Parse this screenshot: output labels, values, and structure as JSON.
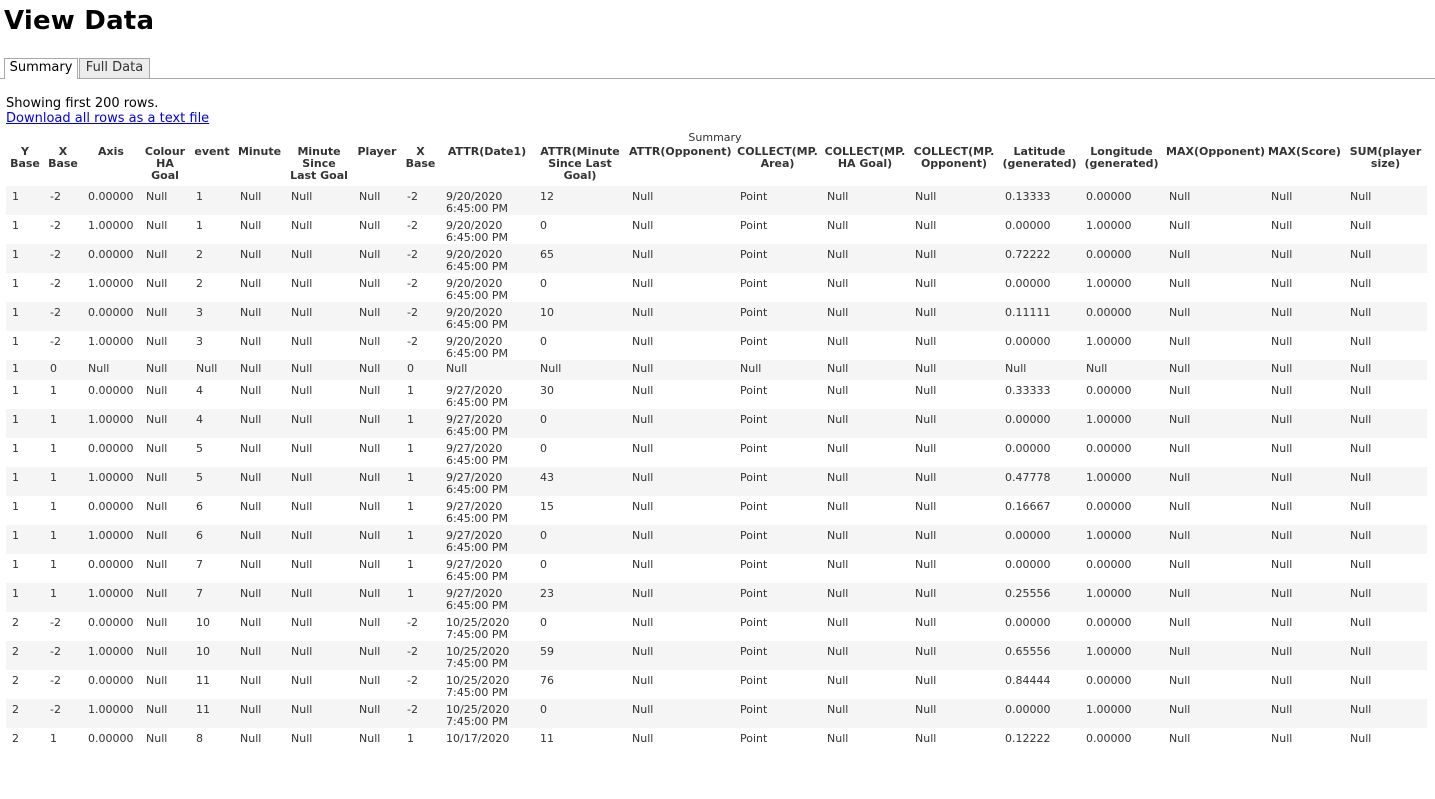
{
  "page": {
    "title": "View Data"
  },
  "tabs": [
    {
      "label": "Summary",
      "active": true
    },
    {
      "label": "Full Data",
      "active": false
    }
  ],
  "info": {
    "showing": "Showing first 200 rows.",
    "download": "Download all rows as a text file"
  },
  "table": {
    "caption": "Summary",
    "columns": [
      [
        "Y",
        "Base"
      ],
      [
        "X",
        "Base"
      ],
      [
        "Axis"
      ],
      [
        "Colour",
        "HA",
        "Goal"
      ],
      [
        "event"
      ],
      [
        "Minute"
      ],
      [
        "Minute",
        "Since",
        "Last Goal"
      ],
      [
        "Player"
      ],
      [
        "X",
        "Base"
      ],
      [
        "ATTR(Date1)"
      ],
      [
        "ATTR(Minute",
        "Since Last",
        "Goal)"
      ],
      [
        "ATTR(Opponent)"
      ],
      [
        "COLLECT(MP.",
        "Area)"
      ],
      [
        "COLLECT(MP.",
        "HA Goal)"
      ],
      [
        "COLLECT(MP.",
        "Opponent)"
      ],
      [
        "Latitude",
        "(generated)"
      ],
      [
        "Longitude",
        "(generated)"
      ],
      [
        "MAX(Opponent)"
      ],
      [
        "MAX(Score)"
      ],
      [
        "SUM(player",
        "size)"
      ]
    ],
    "rows": [
      [
        "1",
        "-2",
        "0.00000",
        "Null",
        "1",
        "Null",
        "Null",
        "Null",
        "-2",
        [
          "9/20/2020",
          "6:45:00 PM"
        ],
        "12",
        "Null",
        "Point",
        "Null",
        "Null",
        "0.13333",
        "0.00000",
        "Null",
        "Null",
        "Null"
      ],
      [
        "1",
        "-2",
        "1.00000",
        "Null",
        "1",
        "Null",
        "Null",
        "Null",
        "-2",
        [
          "9/20/2020",
          "6:45:00 PM"
        ],
        "0",
        "Null",
        "Point",
        "Null",
        "Null",
        "0.00000",
        "1.00000",
        "Null",
        "Null",
        "Null"
      ],
      [
        "1",
        "-2",
        "0.00000",
        "Null",
        "2",
        "Null",
        "Null",
        "Null",
        "-2",
        [
          "9/20/2020",
          "6:45:00 PM"
        ],
        "65",
        "Null",
        "Point",
        "Null",
        "Null",
        "0.72222",
        "0.00000",
        "Null",
        "Null",
        "Null"
      ],
      [
        "1",
        "-2",
        "1.00000",
        "Null",
        "2",
        "Null",
        "Null",
        "Null",
        "-2",
        [
          "9/20/2020",
          "6:45:00 PM"
        ],
        "0",
        "Null",
        "Point",
        "Null",
        "Null",
        "0.00000",
        "1.00000",
        "Null",
        "Null",
        "Null"
      ],
      [
        "1",
        "-2",
        "0.00000",
        "Null",
        "3",
        "Null",
        "Null",
        "Null",
        "-2",
        [
          "9/20/2020",
          "6:45:00 PM"
        ],
        "10",
        "Null",
        "Point",
        "Null",
        "Null",
        "0.11111",
        "0.00000",
        "Null",
        "Null",
        "Null"
      ],
      [
        "1",
        "-2",
        "1.00000",
        "Null",
        "3",
        "Null",
        "Null",
        "Null",
        "-2",
        [
          "9/20/2020",
          "6:45:00 PM"
        ],
        "0",
        "Null",
        "Point",
        "Null",
        "Null",
        "0.00000",
        "1.00000",
        "Null",
        "Null",
        "Null"
      ],
      [
        "1",
        "0",
        "Null",
        "Null",
        "Null",
        "Null",
        "Null",
        "Null",
        "0",
        [
          "Null"
        ],
        "Null",
        "Null",
        "Null",
        "Null",
        "Null",
        "Null",
        "Null",
        "Null",
        "Null",
        "Null"
      ],
      [
        "1",
        "1",
        "0.00000",
        "Null",
        "4",
        "Null",
        "Null",
        "Null",
        "1",
        [
          "9/27/2020",
          "6:45:00 PM"
        ],
        "30",
        "Null",
        "Point",
        "Null",
        "Null",
        "0.33333",
        "0.00000",
        "Null",
        "Null",
        "Null"
      ],
      [
        "1",
        "1",
        "1.00000",
        "Null",
        "4",
        "Null",
        "Null",
        "Null",
        "1",
        [
          "9/27/2020",
          "6:45:00 PM"
        ],
        "0",
        "Null",
        "Point",
        "Null",
        "Null",
        "0.00000",
        "1.00000",
        "Null",
        "Null",
        "Null"
      ],
      [
        "1",
        "1",
        "0.00000",
        "Null",
        "5",
        "Null",
        "Null",
        "Null",
        "1",
        [
          "9/27/2020",
          "6:45:00 PM"
        ],
        "0",
        "Null",
        "Point",
        "Null",
        "Null",
        "0.00000",
        "0.00000",
        "Null",
        "Null",
        "Null"
      ],
      [
        "1",
        "1",
        "1.00000",
        "Null",
        "5",
        "Null",
        "Null",
        "Null",
        "1",
        [
          "9/27/2020",
          "6:45:00 PM"
        ],
        "43",
        "Null",
        "Point",
        "Null",
        "Null",
        "0.47778",
        "1.00000",
        "Null",
        "Null",
        "Null"
      ],
      [
        "1",
        "1",
        "0.00000",
        "Null",
        "6",
        "Null",
        "Null",
        "Null",
        "1",
        [
          "9/27/2020",
          "6:45:00 PM"
        ],
        "15",
        "Null",
        "Point",
        "Null",
        "Null",
        "0.16667",
        "0.00000",
        "Null",
        "Null",
        "Null"
      ],
      [
        "1",
        "1",
        "1.00000",
        "Null",
        "6",
        "Null",
        "Null",
        "Null",
        "1",
        [
          "9/27/2020",
          "6:45:00 PM"
        ],
        "0",
        "Null",
        "Point",
        "Null",
        "Null",
        "0.00000",
        "1.00000",
        "Null",
        "Null",
        "Null"
      ],
      [
        "1",
        "1",
        "0.00000",
        "Null",
        "7",
        "Null",
        "Null",
        "Null",
        "1",
        [
          "9/27/2020",
          "6:45:00 PM"
        ],
        "0",
        "Null",
        "Point",
        "Null",
        "Null",
        "0.00000",
        "0.00000",
        "Null",
        "Null",
        "Null"
      ],
      [
        "1",
        "1",
        "1.00000",
        "Null",
        "7",
        "Null",
        "Null",
        "Null",
        "1",
        [
          "9/27/2020",
          "6:45:00 PM"
        ],
        "23",
        "Null",
        "Point",
        "Null",
        "Null",
        "0.25556",
        "1.00000",
        "Null",
        "Null",
        "Null"
      ],
      [
        "2",
        "-2",
        "0.00000",
        "Null",
        "10",
        "Null",
        "Null",
        "Null",
        "-2",
        [
          "10/25/2020",
          "7:45:00 PM"
        ],
        "0",
        "Null",
        "Point",
        "Null",
        "Null",
        "0.00000",
        "0.00000",
        "Null",
        "Null",
        "Null"
      ],
      [
        "2",
        "-2",
        "1.00000",
        "Null",
        "10",
        "Null",
        "Null",
        "Null",
        "-2",
        [
          "10/25/2020",
          "7:45:00 PM"
        ],
        "59",
        "Null",
        "Point",
        "Null",
        "Null",
        "0.65556",
        "1.00000",
        "Null",
        "Null",
        "Null"
      ],
      [
        "2",
        "-2",
        "0.00000",
        "Null",
        "11",
        "Null",
        "Null",
        "Null",
        "-2",
        [
          "10/25/2020",
          "7:45:00 PM"
        ],
        "76",
        "Null",
        "Point",
        "Null",
        "Null",
        "0.84444",
        "0.00000",
        "Null",
        "Null",
        "Null"
      ],
      [
        "2",
        "-2",
        "1.00000",
        "Null",
        "11",
        "Null",
        "Null",
        "Null",
        "-2",
        [
          "10/25/2020",
          "7:45:00 PM"
        ],
        "0",
        "Null",
        "Point",
        "Null",
        "Null",
        "0.00000",
        "1.00000",
        "Null",
        "Null",
        "Null"
      ],
      [
        "2",
        "1",
        "0.00000",
        "Null",
        "8",
        "Null",
        "Null",
        "Null",
        "1",
        [
          "10/17/2020"
        ],
        "11",
        "Null",
        "Point",
        "Null",
        "Null",
        "0.12222",
        "0.00000",
        "Null",
        "Null",
        "Null"
      ]
    ]
  }
}
